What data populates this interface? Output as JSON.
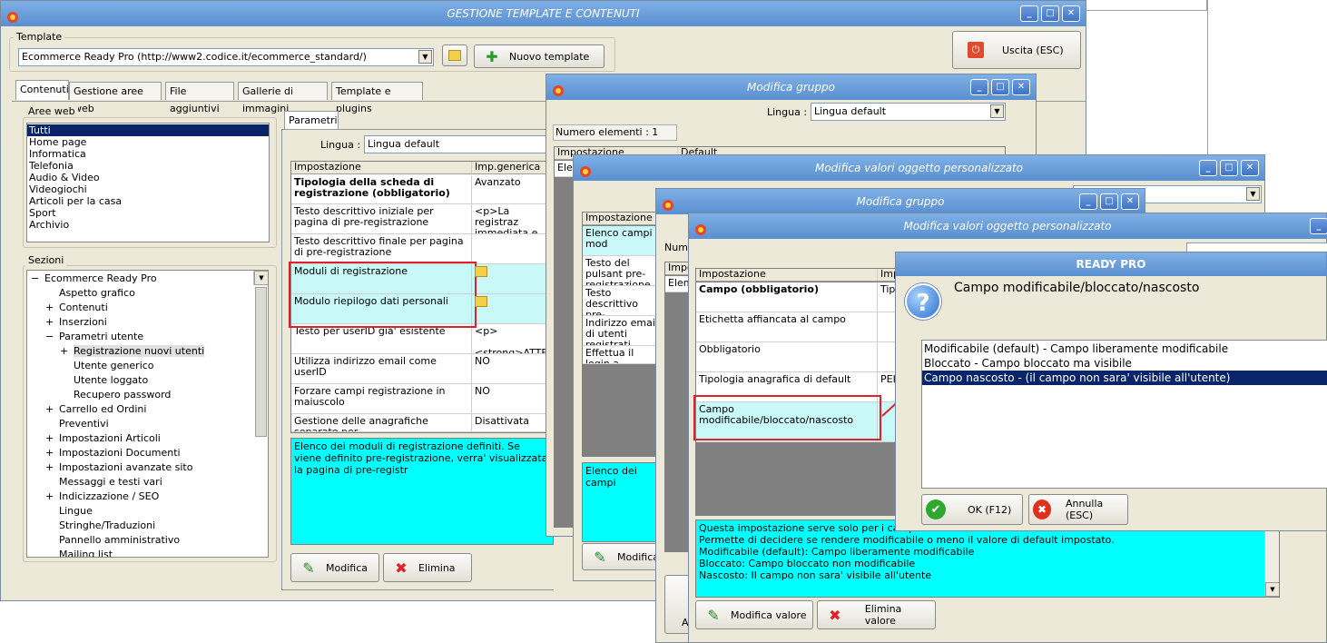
{
  "main_window": {
    "title": "GESTIONE TEMPLATE E CONTENUTI",
    "template_label": "Template",
    "template_value": "Ecommerce Ready Pro (http://www2.codice.it/ecommerce_standard/)",
    "new_template_label": "Nuovo template",
    "exit_label": "Uscita (ESC)",
    "tabs": [
      "Contenuti",
      "Gestione aree web",
      "File aggiuntivi",
      "Gallerie di immagini",
      "Template e plugins"
    ],
    "aree_web_label": "Aree web",
    "aree_web_items": [
      "Tutti",
      "Home page",
      "Informatica",
      "Telefonia",
      "Audio & Video",
      "Videogiochi",
      "Articoli per la casa",
      "Sport",
      "Archivio"
    ],
    "sezioni_label": "Sezioni",
    "tree": [
      {
        "label": "Ecommerce Ready Pro",
        "exp": "−"
      },
      {
        "label": "Aspetto grafico",
        "exp": ""
      },
      {
        "label": "Contenuti",
        "exp": "+"
      },
      {
        "label": "Inserzioni",
        "exp": "+"
      },
      {
        "label": "Parametri utente",
        "exp": "−"
      },
      {
        "label": "Registrazione nuovi utenti",
        "exp": "+"
      },
      {
        "label": "Utente generico",
        "exp": ""
      },
      {
        "label": "Utente loggato",
        "exp": ""
      },
      {
        "label": "Recupero password",
        "exp": ""
      },
      {
        "label": "Carrello ed Ordini",
        "exp": "+"
      },
      {
        "label": "Preventivi",
        "exp": ""
      },
      {
        "label": "Impostazioni Articoli",
        "exp": "+"
      },
      {
        "label": "Impostazioni Documenti",
        "exp": "+"
      },
      {
        "label": "Impostazioni avanzate sito",
        "exp": "+"
      },
      {
        "label": "Messaggi e testi vari",
        "exp": ""
      },
      {
        "label": "Indicizzazione / SEO",
        "exp": "+"
      },
      {
        "label": "Lingue",
        "exp": ""
      },
      {
        "label": "Stringhe/Traduzioni",
        "exp": ""
      },
      {
        "label": "Pannello amministrativo",
        "exp": ""
      },
      {
        "label": "Mailing list",
        "exp": ""
      }
    ],
    "params_tab": "Parametri",
    "lingua_label": "Lingua :",
    "lingua_value": "Lingua default",
    "grid_headers": [
      "Impostazione",
      "Imp.generica"
    ],
    "grid_rows": [
      {
        "name": "Tipologia della scheda di registrazione (obbligatorio)",
        "value": "Avanzato"
      },
      {
        "name": "Testo descrittivo iniziale per pagina di pre-registrazione",
        "value": "<p>La registraz immediata e sem"
      },
      {
        "name": "Testo descrittivo finale per pagina di pre-registrazione",
        "value": ""
      },
      {
        "name": "Moduli di registrazione",
        "value": ""
      },
      {
        "name": "Modulo riepilogo dati personali",
        "value": ""
      },
      {
        "name": "Testo per userID gia' esistente",
        "value": "<p>\n  <strong>ATTE"
      },
      {
        "name": "Utilizza indirizzo email come userID",
        "value": "NO"
      },
      {
        "name": "Forzare campi registrazione in maiuscolo",
        "value": "NO"
      },
      {
        "name": "Gestione delle anagrafiche separate per",
        "value": "Disattivata"
      }
    ],
    "description": "Elenco dei moduli di registrazione definiti. Se viene definito pre-registrazione, verra' visualizzata la pagina di pre-registr",
    "modifica_label": "Modifica",
    "elimina_label": "Elimina"
  },
  "modifica_gruppo_1": {
    "title": "Modifica gruppo",
    "lingua_label": "Lingua :",
    "lingua_value": "Lingua default",
    "num_elements": "Numero elementi : 1",
    "headers": [
      "Impostazione",
      "Default"
    ],
    "row_label": "Elen"
  },
  "valori_oggetto_1": {
    "title": "Modifica valori oggetto personalizzato",
    "grid_header": "Impostazione",
    "rows": [
      "Elenco campi mod",
      "Testo del pulsant pre-registrazione",
      "Testo descrittivo pre-registrazione",
      "Indirizzo email di utenti registrati",
      "Effettua il login a"
    ],
    "description": "Elenco dei campi",
    "modifica_label": "Modifica"
  },
  "modifica_gruppo_2": {
    "title": "Modifica gruppo",
    "num_label": "Nume",
    "header": "Impo",
    "row": "Elem",
    "bottom": "A"
  },
  "valori_oggetto_2": {
    "title": "Modifica valori oggetto personalizzato",
    "headers": [
      "Impostazione",
      "Imp"
    ],
    "rows": [
      {
        "name": "Campo (obbligatorio)",
        "value": "Tipo"
      },
      {
        "name": "Etichetta affiancata al campo",
        "value": ""
      },
      {
        "name": "Obbligatorio",
        "value": ""
      },
      {
        "name": "Tipologia anagrafica di default",
        "value": "PER"
      },
      {
        "name": "Campo modificabile/bloccato/nascosto",
        "value": ""
      }
    ],
    "description_lines": [
      "Questa impostazione serve solo per i campi na",
      "Permette di decidere se rendere modificabile o meno il valore di default impostato.",
      "Modificabile (default): Campo liberamente modificabile",
      "Bloccato: Campo bloccato non modificabile",
      "Nascosto: Il campo non sara' visibile all'utente"
    ],
    "modifica_valore_label": "Modifica valore",
    "elimina_valore_label": "Elimina valore"
  },
  "ready_pro_dialog": {
    "title": "READY PRO",
    "question": "Campo modificabile/bloccato/nascosto",
    "options": [
      "Modificabile (default) - Campo liberamente modificabile",
      "Bloccato - Campo bloccato ma visibile",
      "Campo nascosto - (il campo non sara' visibile all'utente)"
    ],
    "ok_label": "OK (F12)",
    "cancel_label": "Annulla (ESC)"
  },
  "colors": {
    "titlebar": "#6b9edb",
    "window_bg": "#ece9d8",
    "highlight_cyan": "#00ffff",
    "annotation_red": "#e0202a",
    "selection": "#0a246a"
  }
}
